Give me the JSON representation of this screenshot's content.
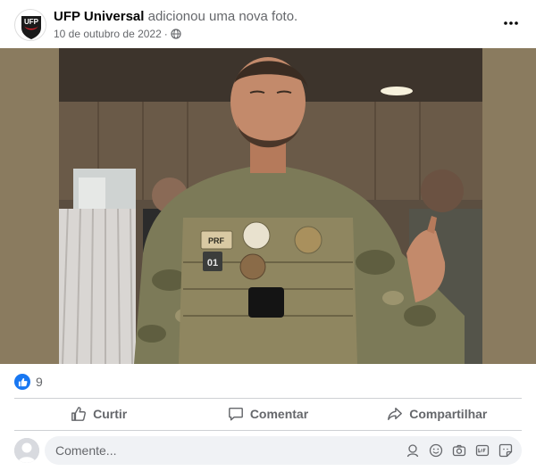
{
  "post": {
    "author": "UFP Universal",
    "action_text": "adicionou uma nova foto.",
    "date": "10 de outubro de 2022",
    "separator": "·",
    "avatar_text": "UFP"
  },
  "photo": {
    "patches": [
      "PRF",
      "01"
    ]
  },
  "reactions": {
    "count": "9"
  },
  "actions": {
    "like": "Curtir",
    "comment": "Comentar",
    "share": "Compartilhar"
  },
  "comment": {
    "placeholder": "Comente..."
  },
  "colors": {
    "accent": "#1877f2",
    "secondary_text": "#65676b",
    "divider": "#ced0d4"
  }
}
